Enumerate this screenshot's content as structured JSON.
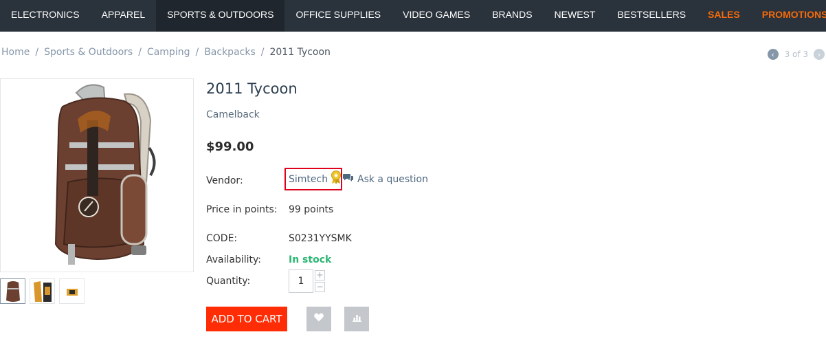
{
  "nav": {
    "items": [
      {
        "label": "ELECTRONICS"
      },
      {
        "label": "APPAREL"
      },
      {
        "label": "SPORTS & OUTDOORS"
      },
      {
        "label": "OFFICE SUPPLIES"
      },
      {
        "label": "VIDEO GAMES"
      },
      {
        "label": "BRANDS"
      },
      {
        "label": "NEWEST"
      },
      {
        "label": "BESTSELLERS"
      },
      {
        "label": "SALES"
      },
      {
        "label": "PROMOTIONS"
      }
    ],
    "active_index": 2,
    "highlight_color": "#f66a0a"
  },
  "breadcrumb": {
    "items": [
      "Home",
      "Sports & Outdoors",
      "Camping",
      "Backpacks"
    ],
    "current": "2011 Tycoon",
    "separator": "/"
  },
  "pager": {
    "text": "3 of 3",
    "prev_icon": "chevron-left-icon",
    "next_icon": "chevron-right-icon"
  },
  "product": {
    "title": "2011 Tycoon",
    "brand": "Camelback",
    "price": "$99.00",
    "vendor_label": "Vendor:",
    "vendor_name": "Simtech",
    "vendor_badge_icon": "award-ribbon-icon",
    "ask_question": "Ask a question",
    "points_label": "Price in points:",
    "points_value": "99 points",
    "code_label": "CODE:",
    "code_value": "S0231YYSMK",
    "availability_label": "Availability:",
    "availability_value": "In stock",
    "quantity_label": "Quantity:",
    "quantity_value": "1",
    "qty_plus": "+",
    "qty_minus": "−",
    "add_to_cart": "ADD TO CART",
    "wishlist_icon": "heart-icon",
    "compare_icon": "bar-chart-icon"
  },
  "colors": {
    "nav_bg": "#2a323b",
    "add_to_cart": "#ff2d05",
    "in_stock": "#2bb673",
    "vendor_highlight_border": "#e0001b"
  }
}
